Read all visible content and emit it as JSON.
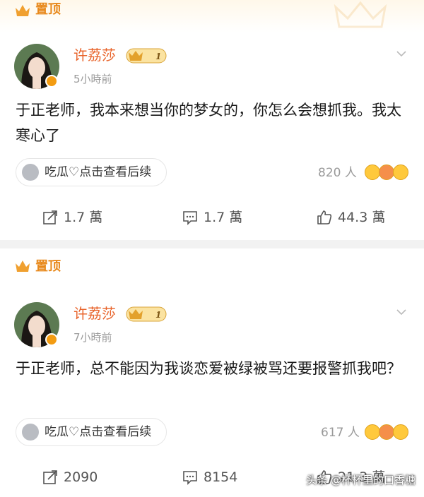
{
  "posts": [
    {
      "pinned_label": "置顶",
      "username": "许荔莎",
      "vip_level": "1",
      "time": "5小時前",
      "content": "于正老师，我本来想当你的梦女的，你怎么会想抓我。我太寒心了",
      "topic": "吃瓜♡点击查看后续",
      "reaction_count": "820 人",
      "repost_count": "1.7 萬",
      "comment_count": "1.7 萬",
      "like_count": "44.3 萬"
    },
    {
      "pinned_label": "置顶",
      "username": "许荔莎",
      "vip_level": "1",
      "time": "7小時前",
      "content": "于正老师，总不能因为我谈恋爱被绿被骂还要报警抓我吧？",
      "topic": "吃瓜♡点击查看后续",
      "reaction_count": "617 人",
      "repost_count": "2090",
      "comment_count": "8154",
      "like_count": "21.3 萬"
    }
  ],
  "watermark": "头条 @杯杯里的口香糖",
  "colors": {
    "pinned": "#e8891c",
    "username": "#e8632a",
    "muted": "#9a9a9a",
    "divider": "#f2f2f2"
  },
  "icons": {
    "pinned": "crown-icon",
    "repost": "share-icon",
    "comment": "comment-icon",
    "like": "thumbs-up-icon",
    "more": "chevron-down-icon"
  }
}
